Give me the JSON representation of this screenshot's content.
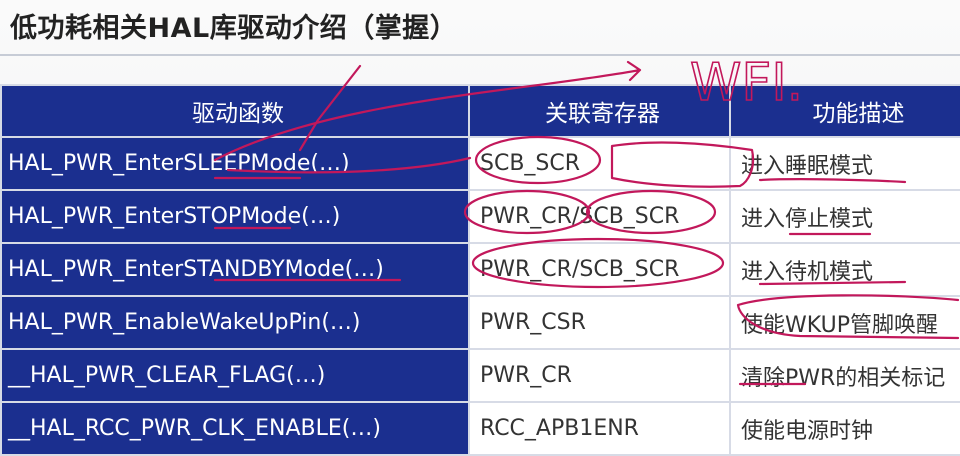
{
  "slide": {
    "title": "低功耗相关HAL库驱动介绍（掌握）",
    "annotation": "WFI."
  },
  "table": {
    "headers": [
      "驱动函数",
      "关联寄存器",
      "功能描述"
    ],
    "rows": [
      {
        "function": "HAL_PWR_EnterSLEEPMode(…)",
        "register": "SCB_SCR",
        "description": "进入睡眠模式"
      },
      {
        "function": "HAL_PWR_EnterSTOPMode(…)",
        "register": "PWR_CR/SCB_SCR",
        "description": "进入停止模式"
      },
      {
        "function": "HAL_PWR_EnterSTANDBYMode(…)",
        "register": "PWR_CR/SCB_SCR",
        "description": "进入待机模式"
      },
      {
        "function": "HAL_PWR_EnableWakeUpPin(…)",
        "register": "PWR_CSR",
        "description": "使能WKUP管脚唤醒"
      },
      {
        "function": "__HAL_PWR_CLEAR_FLAG(…)",
        "register": "PWR_CR",
        "description": "清除PWR的相关标记"
      },
      {
        "function": "__HAL_RCC_PWR_CLK_ENABLE(…)",
        "register": "RCC_APB1ENR",
        "description": "使能电源时钟"
      }
    ]
  },
  "colors": {
    "header_bg": "#1b2f8f",
    "ink": "#c2185b"
  }
}
